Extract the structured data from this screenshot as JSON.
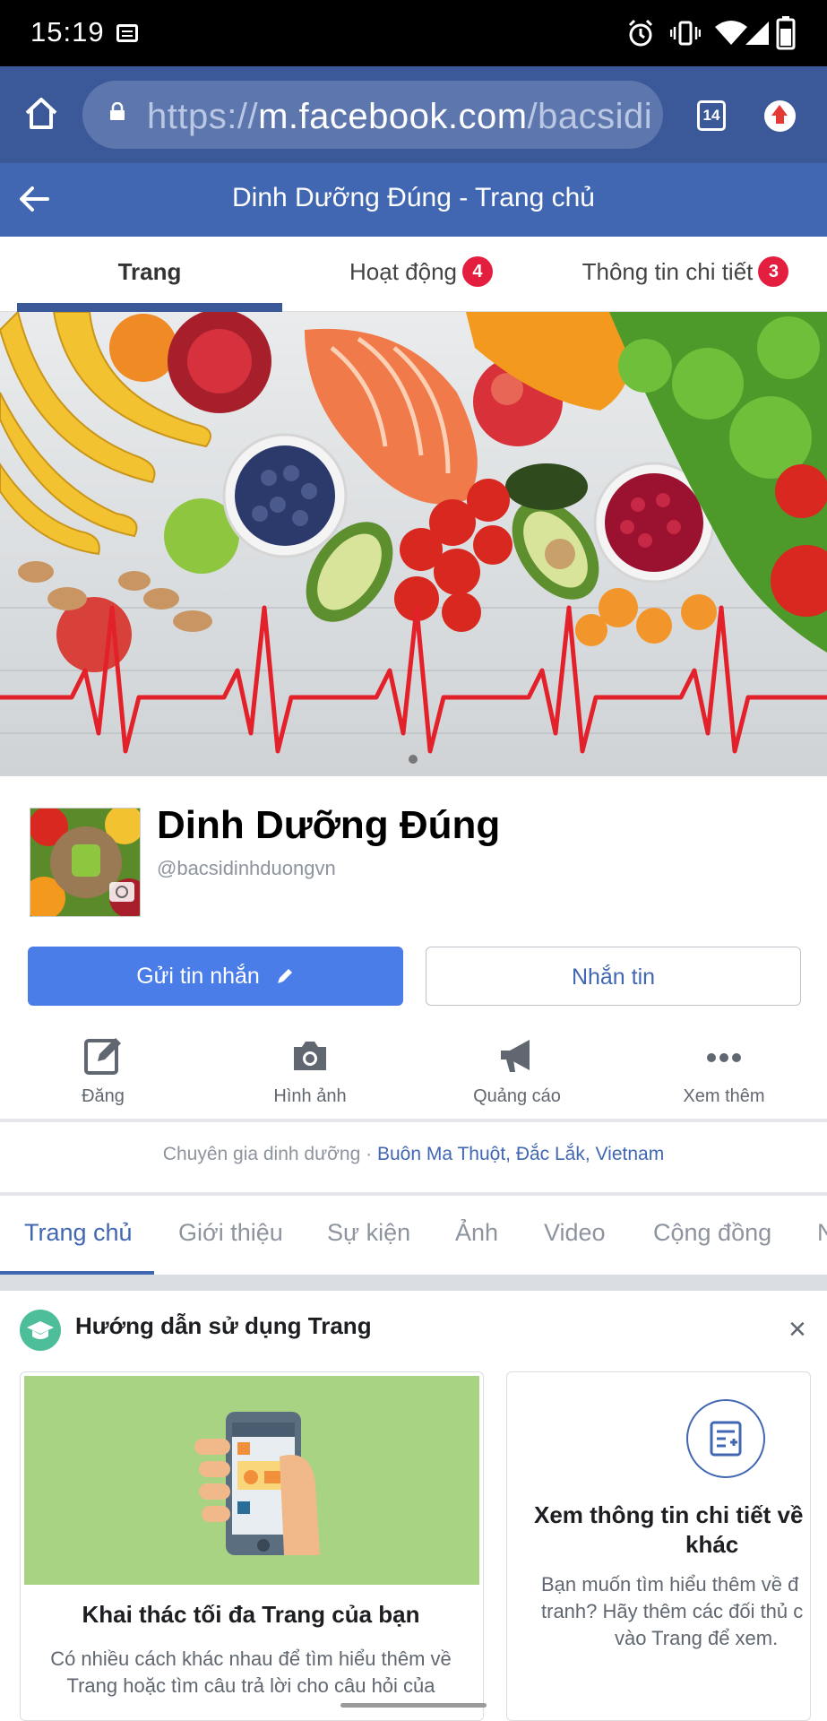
{
  "status_bar": {
    "time": "15:19"
  },
  "browser": {
    "url_prefix": "https://",
    "url_host": "m.facebook.com",
    "url_path": "/bacsidi",
    "tab_count": "14"
  },
  "header": {
    "title": "Dinh Dưỡng Đúng - Trang chủ"
  },
  "top_tabs": [
    {
      "label": "Trang"
    },
    {
      "label": "Hoạt động",
      "badge": "4"
    },
    {
      "label": "Thông tin chi tiết",
      "badge": "3"
    }
  ],
  "profile": {
    "name": "Dinh Dưỡng Đúng",
    "handle": "@bacsidinhduongvn"
  },
  "buttons": {
    "send_message": "Gửi tin nhắn",
    "message": "Nhắn tin"
  },
  "actions": [
    {
      "label": "Đăng",
      "icon": "edit-icon"
    },
    {
      "label": "Hình ảnh",
      "icon": "camera-icon"
    },
    {
      "label": "Quảng cáo",
      "icon": "megaphone-icon"
    },
    {
      "label": "Xem thêm",
      "icon": "more-icon"
    }
  ],
  "category": {
    "type": "Chuyên gia dinh dưỡng",
    "separator": " · ",
    "location": "Buôn Ma Thuột, Đắc Lắk, Vietnam"
  },
  "section_tabs": [
    "Trang chủ",
    "Giới thiệu",
    "Sự kiện",
    "Ảnh",
    "Video",
    "Cộng đồng",
    "N"
  ],
  "guide": {
    "title": "Hướng dẫn sử dụng Trang",
    "card1": {
      "title": "Khai thác tối đa Trang của bạn",
      "body": "Có nhiều cách khác nhau để tìm hiểu thêm về Trang hoặc tìm câu trả lời cho câu hỏi của"
    },
    "card2": {
      "title_line1": "Xem thông tin chi tiết về c",
      "title_line2": "khác",
      "body_line1": "Bạn muốn tìm hiểu thêm về đ",
      "body_line2": "tranh? Hãy thêm các đối thủ c",
      "body_line3": "vào Trang để xem."
    }
  },
  "colors": {
    "facebook_blue": "#3b5998",
    "header_blue": "#4267b2",
    "button_blue": "#4a7de8",
    "badge_red": "#e41e3f"
  }
}
